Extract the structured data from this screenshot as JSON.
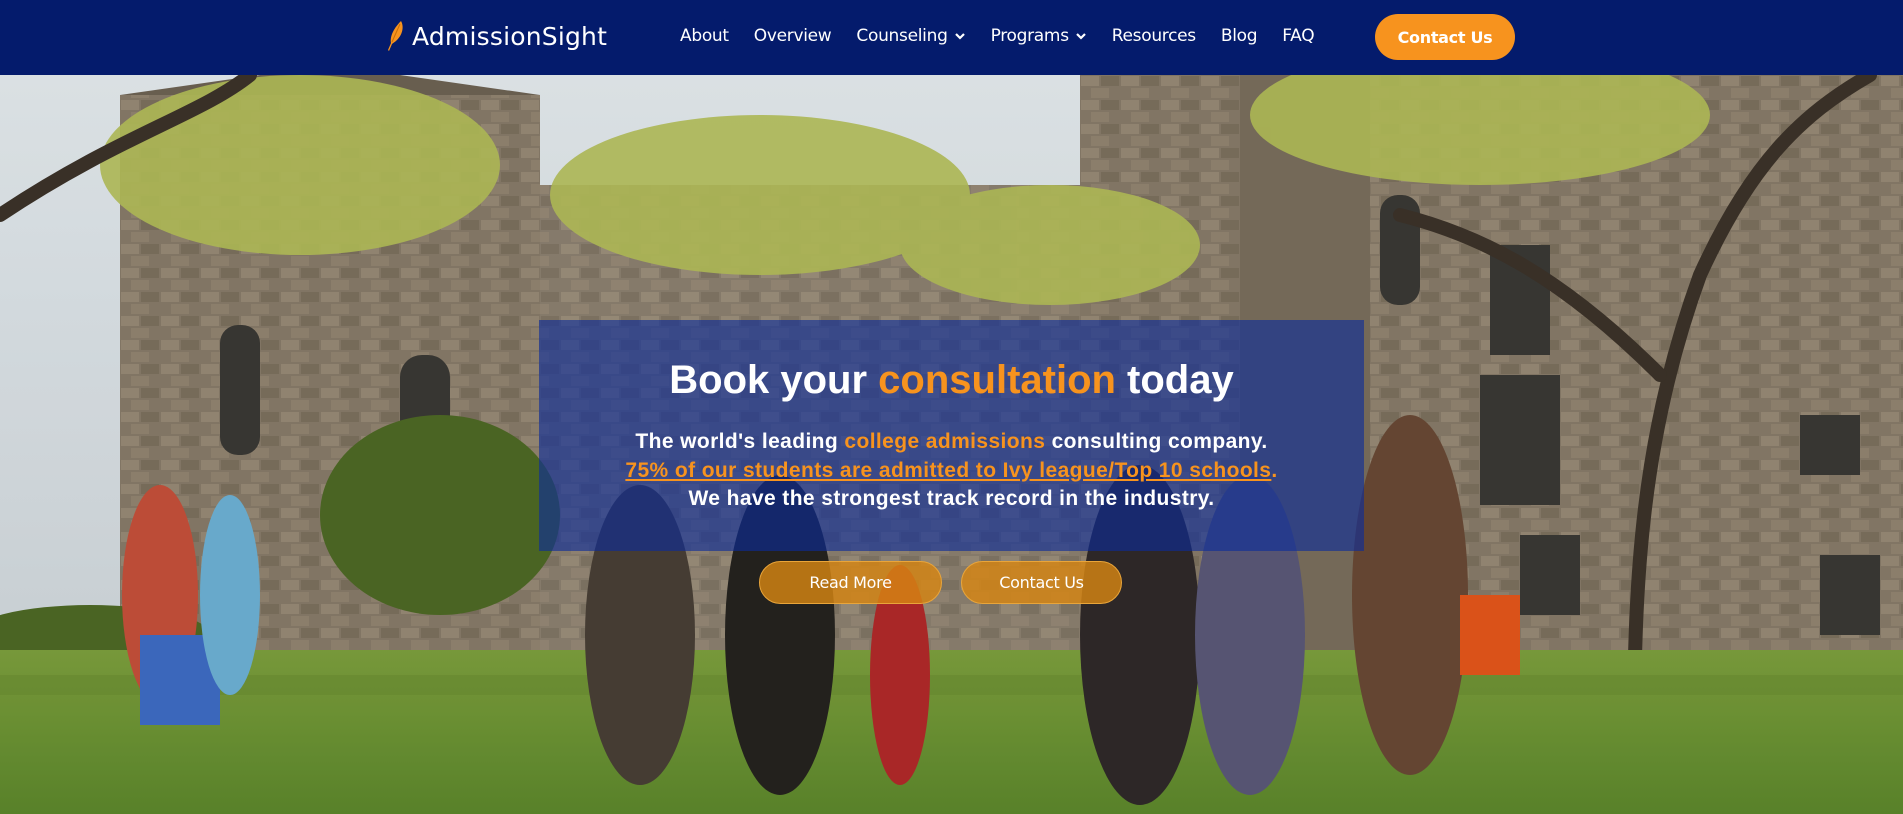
{
  "brand": {
    "name": "AdmissionSight",
    "accent_color": "#f7931e",
    "nav_color": "#041b6c"
  },
  "nav": {
    "items": [
      {
        "label": "About",
        "has_dropdown": false
      },
      {
        "label": "Overview",
        "has_dropdown": false
      },
      {
        "label": "Counseling",
        "has_dropdown": true
      },
      {
        "label": "Programs",
        "has_dropdown": true
      },
      {
        "label": "Resources",
        "has_dropdown": false
      },
      {
        "label": "Blog",
        "has_dropdown": false
      },
      {
        "label": "FAQ",
        "has_dropdown": false
      }
    ],
    "cta_label": "Contact Us"
  },
  "hero": {
    "headline_part1": "Book your ",
    "headline_accent": "consultation",
    "headline_part2": " today",
    "line1_part1": "The world's leading ",
    "line1_accent": "college admissions",
    "line1_part2": " consulting company.",
    "line2_link": "75% of our students are admitted to Ivy league/Top 10 schools",
    "line2_end": ".",
    "line3": "We have the strongest track record in the industry.",
    "read_more_label": "Read More",
    "contact_label": "Contact Us"
  }
}
